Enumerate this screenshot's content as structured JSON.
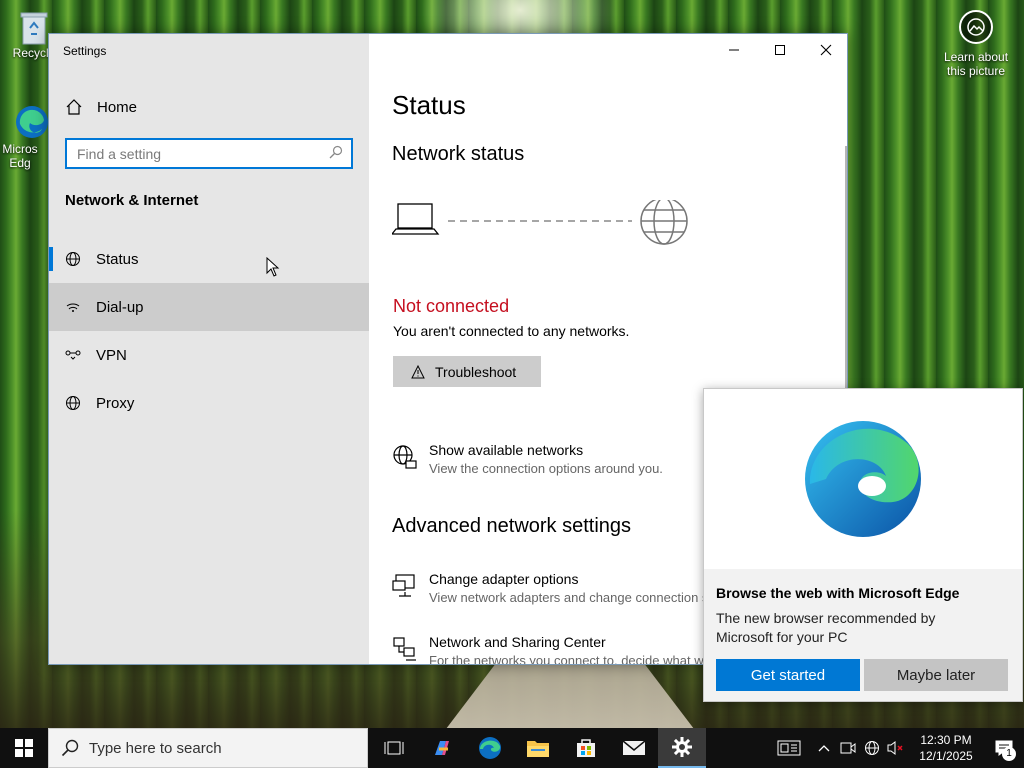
{
  "desktop": {
    "icons": [
      {
        "label": "Recycle",
        "icon": "recycle-bin-icon"
      },
      {
        "label": "Micros Edg",
        "icon": "edge-icon"
      }
    ],
    "learn_about": "Learn about this picture"
  },
  "window": {
    "title": "Settings",
    "controls": {
      "minimize": "minimize-icon",
      "maximize": "maximize-icon",
      "close": "close-icon"
    }
  },
  "sidebar": {
    "home_label": "Home",
    "search_placeholder": "Find a setting",
    "section_title": "Network & Internet",
    "items": [
      {
        "label": "Status",
        "icon": "globe-icon",
        "state": "selected"
      },
      {
        "label": "Dial-up",
        "icon": "dialup-icon",
        "state": "hover"
      },
      {
        "label": "VPN",
        "icon": "vpn-icon",
        "state": "normal"
      },
      {
        "label": "Proxy",
        "icon": "globe-icon",
        "state": "normal"
      }
    ]
  },
  "main": {
    "title": "Status",
    "network_status_heading": "Network status",
    "status_text": "Not connected",
    "status_desc": "You aren't connected to any networks.",
    "troubleshoot_label": "Troubleshoot",
    "show_networks": {
      "title": "Show available networks",
      "desc": "View the connection options around you."
    },
    "advanced_heading": "Advanced network settings",
    "change_adapter": {
      "title": "Change adapter options",
      "desc": "View network adapters and change connection s"
    },
    "sharing_center": {
      "title": "Network and Sharing Center",
      "desc": "For the networks you connect to, decide what w"
    }
  },
  "edge_popup": {
    "title": "Browse the web with Microsoft Edge",
    "desc": "The new browser recommended by Microsoft for your PC",
    "primary_label": "Get started",
    "secondary_label": "Maybe later"
  },
  "taskbar": {
    "search_placeholder": "Type here to search",
    "apps": [
      "task-view-icon",
      "copilot-icon",
      "edge-icon",
      "file-explorer-icon",
      "store-icon",
      "mail-icon",
      "settings-icon"
    ],
    "time": "12:30 PM",
    "date": "12/1/2025",
    "notification_count": "1"
  },
  "colors": {
    "accent": "#0078d7",
    "error": "#c50f1f",
    "taskbar": "#101010",
    "sidebar": "#e6e6e6"
  }
}
